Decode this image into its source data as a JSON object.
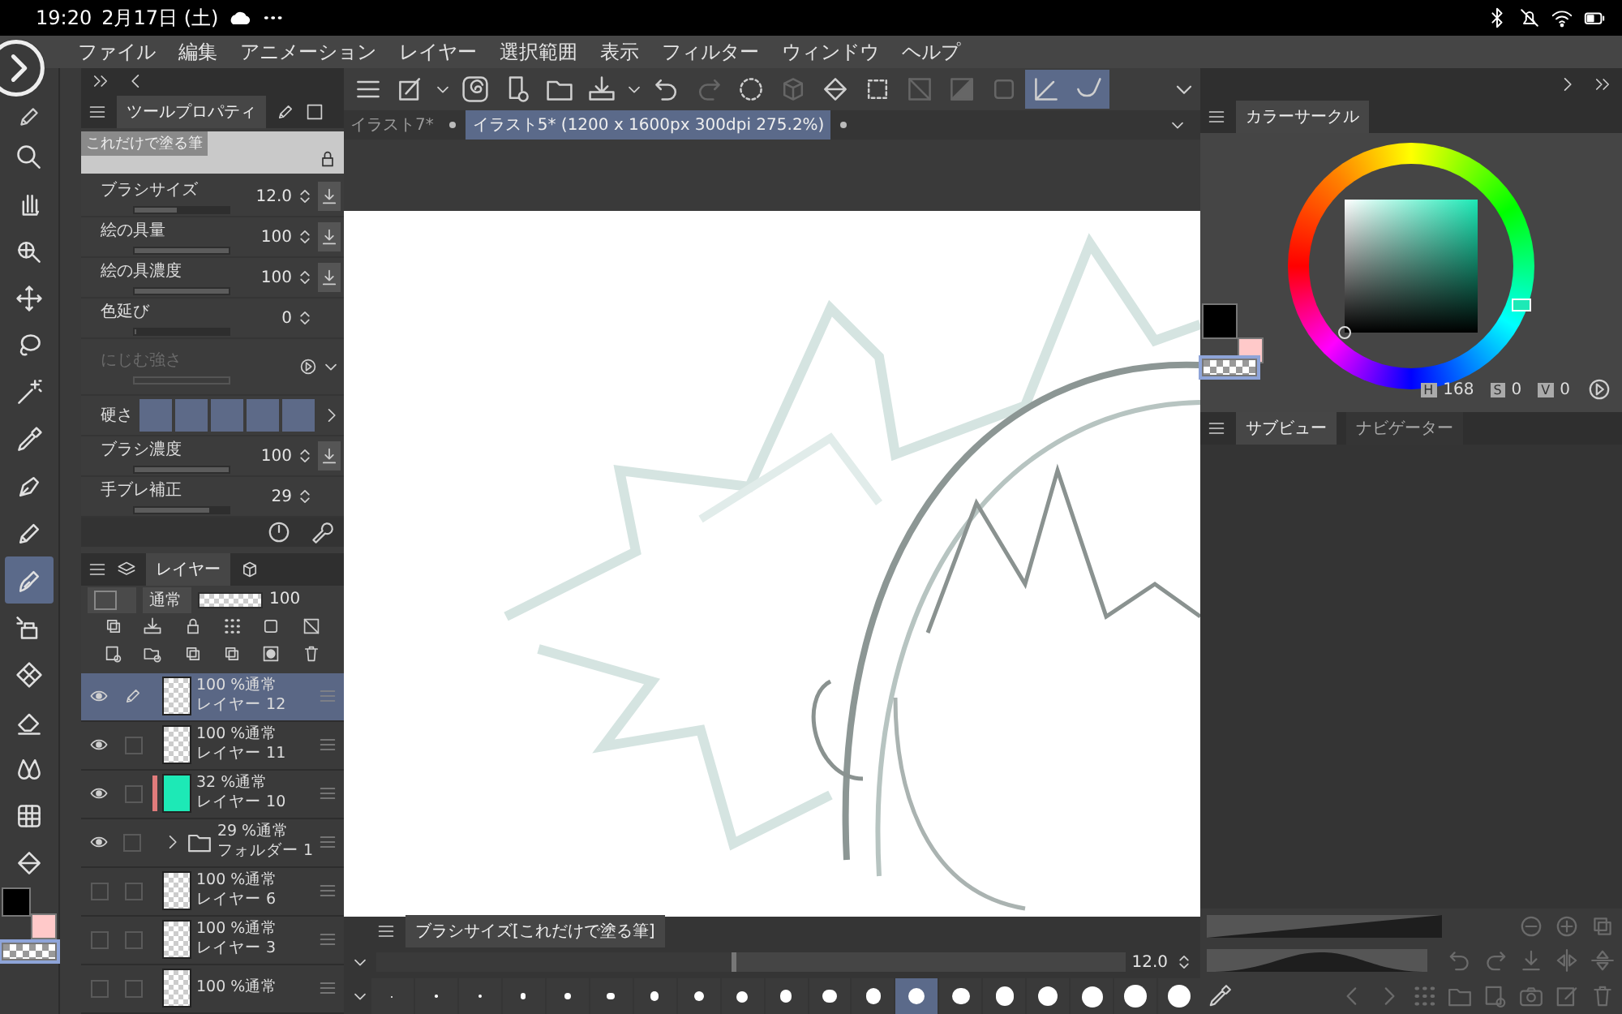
{
  "status_bar": {
    "time": "19:20",
    "date": "2月17日 (土)"
  },
  "menu": [
    "ファイル",
    "編集",
    "アニメーション",
    "レイヤー",
    "選択範囲",
    "表示",
    "フィルター",
    "ウィンドウ",
    "ヘルプ"
  ],
  "tools": [
    {
      "kind": "magnifier",
      "selected": false
    },
    {
      "kind": "hand",
      "selected": false
    },
    {
      "kind": "rotate",
      "selected": false
    },
    {
      "kind": "move",
      "selected": false
    },
    {
      "kind": "lasso",
      "selected": false
    },
    {
      "kind": "wand",
      "selected": false
    },
    {
      "kind": "dropper",
      "selected": false
    },
    {
      "kind": "pen",
      "selected": false
    },
    {
      "kind": "pencil",
      "selected": false
    },
    {
      "kind": "brush",
      "selected": true
    },
    {
      "kind": "spray",
      "selected": false
    },
    {
      "kind": "pattern",
      "selected": false
    },
    {
      "kind": "eraser",
      "selected": false
    },
    {
      "kind": "drops",
      "selected": false
    },
    {
      "kind": "grid",
      "selected": false
    },
    {
      "kind": "bucket",
      "selected": false
    }
  ],
  "color_swatches": [
    {
      "kind": "main",
      "color": "#000000",
      "selected": false
    },
    {
      "kind": "sub",
      "color": "#ffc9c9",
      "selected": false
    },
    {
      "kind": "transparent",
      "selected": true
    }
  ],
  "tool_property": {
    "title": "ツールプロパティ",
    "brush_name": "これだけで塗る筆",
    "params": [
      {
        "kind": "slider",
        "label": "ブラシサイズ",
        "value": "12.0",
        "level": 0.45,
        "reset": true
      },
      {
        "kind": "slider",
        "label": "絵の具量",
        "value": "100",
        "level": 1,
        "reset": true
      },
      {
        "kind": "slider",
        "label": "絵の具濃度",
        "value": "100",
        "level": 1,
        "reset": true
      },
      {
        "kind": "slider",
        "label": "色延び",
        "value": "0",
        "level": 0,
        "reset": false
      },
      {
        "kind": "disabled",
        "label": "にじむ強さ"
      },
      {
        "kind": "hardness",
        "label": "硬さ"
      },
      {
        "kind": "slider",
        "label": "ブラシ濃度",
        "value": "100",
        "level": 1,
        "reset": true
      },
      {
        "kind": "slider",
        "label": "手ブレ補正",
        "value": "29",
        "level": 0.8,
        "reset": false
      }
    ]
  },
  "layer_panel": {
    "title": "レイヤー",
    "blend_mode": "通常",
    "opacity": "100",
    "opacity_slider": {
      "level": 1
    },
    "layers": [
      {
        "kind": "layer",
        "mode": "100 %通常",
        "name": "レイヤー 12",
        "visible": true,
        "editing": true,
        "selected": true
      },
      {
        "kind": "layer",
        "mode": "100 %通常",
        "name": "レイヤー 11",
        "visible": true,
        "editing": false,
        "selected": false
      },
      {
        "kind": "fill",
        "mode": "32 %通常",
        "name": "レイヤー 10",
        "visible": true,
        "editing": false,
        "selected": false,
        "color": "#e07b7b"
      },
      {
        "kind": "folder",
        "mode": "29 %通常",
        "name": "フォルダー 1",
        "visible": true,
        "editing": false,
        "selected": false,
        "expanded": false
      },
      {
        "kind": "layer",
        "mode": "100 %通常",
        "name": "レイヤー 6",
        "visible": false,
        "editing": false,
        "selected": false
      },
      {
        "kind": "layer",
        "mode": "100 %通常",
        "name": "レイヤー 3",
        "visible": false,
        "editing": false,
        "selected": false
      },
      {
        "kind": "layer",
        "mode": "100 %通常",
        "visible": false,
        "editing": false,
        "selected": false
      }
    ]
  },
  "toolbar": [
    {
      "kind": "menu",
      "selected": false,
      "disabled": false
    },
    {
      "kind": "frame",
      "selected": false,
      "disabled": false
    },
    {
      "kind": "caret",
      "selected": false,
      "disabled": false
    },
    {
      "kind": "spiral",
      "selected": false,
      "disabled": false
    },
    {
      "kind": "page-plus",
      "selected": false,
      "disabled": false
    },
    {
      "kind": "folder",
      "selected": false,
      "disabled": false
    },
    {
      "kind": "tray",
      "selected": false,
      "disabled": false
    },
    {
      "kind": "caret",
      "selected": false,
      "disabled": false
    },
    {
      "kind": "undo",
      "selected": false,
      "disabled": false
    },
    {
      "kind": "redo",
      "selected": false,
      "disabled": true
    },
    {
      "kind": "dotted-circle",
      "selected": false,
      "disabled": false
    },
    {
      "kind": "cube",
      "selected": false,
      "disabled": true
    },
    {
      "kind": "bucket",
      "selected": false,
      "disabled": false
    },
    {
      "kind": "selection",
      "selected": false,
      "disabled": false
    },
    {
      "kind": "slashed-square",
      "selected": false,
      "disabled": true
    },
    {
      "kind": "half-square",
      "selected": false,
      "disabled": true
    },
    {
      "kind": "square",
      "selected": false,
      "disabled": true
    },
    {
      "kind": "corner-arrow",
      "selected": true,
      "disabled": false
    },
    {
      "kind": "curve",
      "selected": true,
      "disabled": false
    }
  ],
  "document_tabs": [
    {
      "label": "イラスト7*",
      "selected": false
    },
    {
      "label": "イラスト5* (1200 x 1600px 300dpi 275.2%)",
      "selected": true
    }
  ],
  "color_panel": {
    "title": "カラーサークル",
    "hsv": [
      {
        "key": "H",
        "value": "168"
      },
      {
        "key": "S",
        "value": "0"
      },
      {
        "key": "V",
        "value": "0"
      }
    ]
  },
  "side_tabs": [
    {
      "label": "サブビュー",
      "selected": true
    },
    {
      "label": "ナビゲーター",
      "selected": false
    }
  ],
  "brush_size_panel": {
    "title": "ブラシサイズ[これだけで塗る筆]",
    "value": "12.0",
    "level": 0.48,
    "presets": [
      {
        "selected": false
      },
      {
        "selected": false
      },
      {
        "selected": false
      },
      {
        "selected": false
      },
      {
        "selected": false
      },
      {
        "selected": false
      },
      {
        "selected": false
      },
      {
        "selected": false
      },
      {
        "selected": false
      },
      {
        "selected": false
      },
      {
        "selected": false
      },
      {
        "selected": false
      },
      {
        "selected": true
      },
      {
        "selected": false
      },
      {
        "selected": false
      },
      {
        "selected": false
      },
      {
        "selected": false
      },
      {
        "selected": false
      },
      {
        "selected": false
      }
    ]
  }
}
